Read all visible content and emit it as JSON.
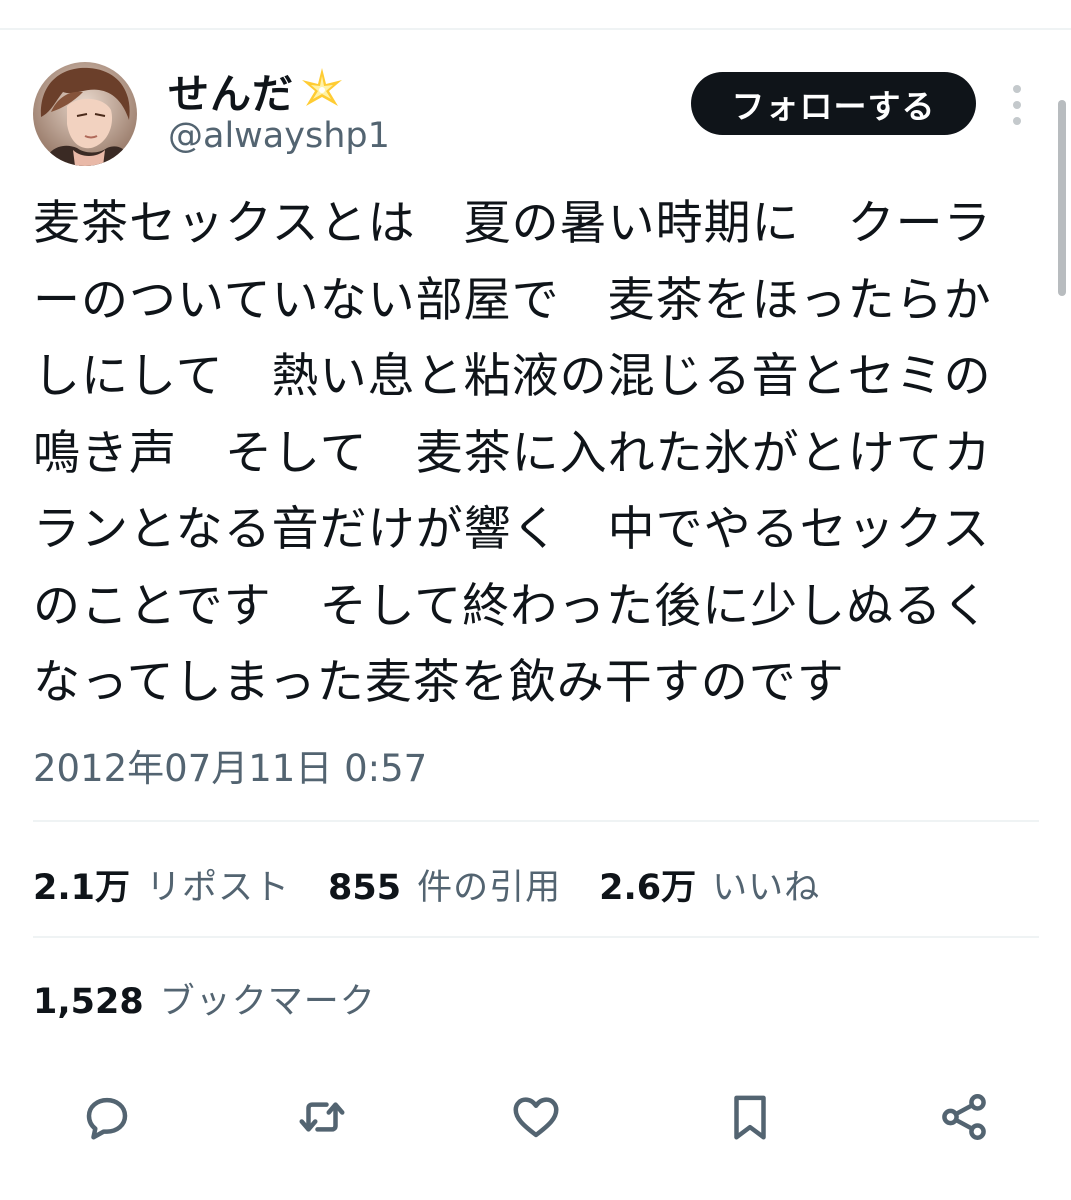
{
  "author": {
    "display_name": "せんだ",
    "name_emoji": "sparkle-star-icon",
    "handle": "@alwayshp1",
    "avatar": "avatar"
  },
  "follow_label": "フォローする",
  "tweet": {
    "lines": [
      "麦茶セックスとは　夏の暑い時期に　クーラ",
      "ーのついていない部屋で　麦茶をほったらか",
      "しにして　熱い息と粘液の混じる音とセミの",
      "鳴き声　そして　麦茶に入れた氷がとけてカ",
      "ランとなる音だけが響く　中でやるセックス",
      "のことです　そして終わった後に少しぬるく",
      "なってしまった麦茶を飲み干すのです"
    ],
    "timestamp": "2012年07月11日 0:57"
  },
  "stats": {
    "reposts": {
      "count": "2.1万",
      "label": "リポスト"
    },
    "quotes": {
      "count": "855",
      "label": "件の引用"
    },
    "likes": {
      "count": "2.6万",
      "label": "いいね"
    },
    "bookmarks": {
      "count": "1,528",
      "label": "ブックマーク"
    }
  },
  "actions": [
    "reply-icon",
    "retweet-icon",
    "like-icon",
    "bookmark-icon",
    "share-icon"
  ],
  "colors": {
    "text_primary": "#0f1419",
    "text_secondary": "#536471",
    "divider": "#eff3f4",
    "button_bg": "#0f1419",
    "button_text": "#ffffff"
  }
}
